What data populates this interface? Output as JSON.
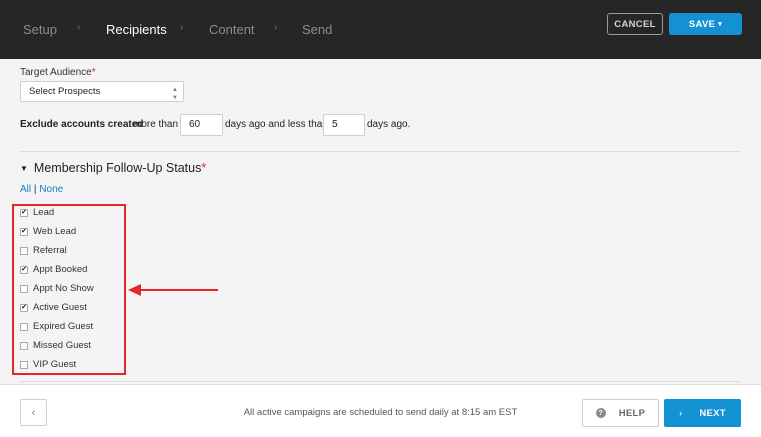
{
  "wizard": {
    "steps": [
      {
        "label": "Setup",
        "active": false
      },
      {
        "label": "Recipients",
        "active": true
      },
      {
        "label": "Content",
        "active": false
      },
      {
        "label": "Send",
        "active": false
      }
    ],
    "step_separator": "›",
    "cancel_label": "CANCEL",
    "save_label": "SAVE",
    "save_caret": "▾"
  },
  "target_audience": {
    "label": "Target Audience",
    "required_mark": "*",
    "selected": "Select Prospects",
    "select_arrows": "▲▼"
  },
  "exclude": {
    "bold_text": "Exclude accounts created",
    "more_than": "more than",
    "min_days": "60",
    "mid_text": "days ago and less than",
    "max_days": "5",
    "end_text": "days ago."
  },
  "membership": {
    "toggle": "▼",
    "title": "Membership Follow-Up Status",
    "required_mark": "*",
    "all_link": "All",
    "separator": "|",
    "none_link": "None",
    "statuses": [
      {
        "label": "Lead",
        "checked": true
      },
      {
        "label": "Web Lead",
        "checked": true
      },
      {
        "label": "Referral",
        "checked": false
      },
      {
        "label": "Appt Booked",
        "checked": true
      },
      {
        "label": "Appt No Show",
        "checked": false
      },
      {
        "label": "Active Guest",
        "checked": true
      },
      {
        "label": "Expired Guest",
        "checked": false
      },
      {
        "label": "Missed Guest",
        "checked": false
      },
      {
        "label": "VIP Guest",
        "checked": false
      }
    ]
  },
  "annotation": {
    "color": "#e0282d"
  },
  "footer": {
    "back_icon": "‹",
    "note": "All active campaigns are scheduled to send daily at 8:15 am EST",
    "help_icon": "?",
    "help_label": "HELP",
    "next_icon": "›",
    "next_label": "NEXT"
  },
  "colors": {
    "accent": "#1491d2",
    "topbar": "#262626",
    "required": "#d9262c",
    "link": "#1a7fc2"
  }
}
